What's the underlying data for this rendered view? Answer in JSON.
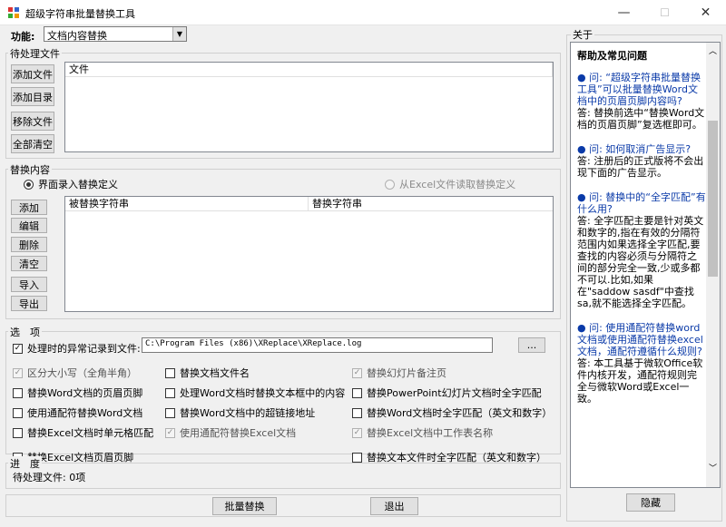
{
  "window": {
    "title": "超级字符串批量替换工具",
    "min": "—",
    "max": "☐",
    "close": "✕"
  },
  "function": {
    "label": "功能:",
    "value": "文档内容替换"
  },
  "pending": {
    "legend": "待处理文件",
    "buttons": [
      "添加文件",
      "添加目录",
      "移除文件",
      "全部清空"
    ],
    "column": "文件"
  },
  "replace": {
    "legend": "替换内容",
    "radio_ui": "界面录入替换定义",
    "radio_excel": "从Excel文件读取替换定义",
    "buttons": [
      "添加",
      "编辑",
      "删除",
      "清空",
      "导入",
      "导出"
    ],
    "columns": [
      "被替换字符串",
      "替换字符串"
    ]
  },
  "options": {
    "legend": "选　项",
    "log_label": "处理时的异常记录到文件:",
    "log_path": "C:\\Program Files (x86)\\XReplace\\XReplace.log",
    "browse": "...",
    "col1": [
      {
        "label": "区分大小写（全角半角）",
        "checked": true,
        "disabled": true
      },
      {
        "label": "替换Word文档的页眉页脚",
        "checked": false,
        "disabled": false
      },
      {
        "label": "使用通配符替换Word文档",
        "checked": false,
        "disabled": false
      },
      {
        "label": "替换Excel文档时单元格匹配",
        "checked": false,
        "disabled": false
      },
      {
        "label": "替换Excel文档页眉页脚",
        "checked": false,
        "disabled": false
      }
    ],
    "col2": [
      {
        "label": "替换文档文件名",
        "checked": false,
        "disabled": false
      },
      {
        "label": "处理Word文档时替换文本框中的内容",
        "checked": false,
        "disabled": false
      },
      {
        "label": "替换Word文档中的超链接地址",
        "checked": false,
        "disabled": false
      },
      {
        "label": "使用通配符替换Excel文档",
        "checked": true,
        "disabled": true
      }
    ],
    "col3": [
      {
        "label": "替换幻灯片备注页",
        "checked": true,
        "disabled": true
      },
      {
        "label": "替换PowerPoint幻灯片文档时全字匹配",
        "checked": false,
        "disabled": false
      },
      {
        "label": "替换Word文档时全字匹配（英文和数字）",
        "checked": false,
        "disabled": false
      },
      {
        "label": "替换Excel文档中工作表名称",
        "checked": true,
        "disabled": true
      },
      {
        "label": "替换文本文件时全字匹配（英文和数字）",
        "checked": false,
        "disabled": false
      }
    ]
  },
  "progress": {
    "legend": "进　度",
    "status": "待处理文件: 0项"
  },
  "bottom": {
    "batch": "批量替换",
    "exit": "退出"
  },
  "about": {
    "legend": "关于",
    "title": "帮助及常见问题",
    "items": [
      {
        "q": "● 问: “超级字符串批量替换工具”可以批量替换Word文档中的页眉页脚内容吗?",
        "a": "答: 替换前选中“替换Word文档的页眉页脚”复选框即可。"
      },
      {
        "q": "● 问: 如何取消广告显示?",
        "a": "答: 注册后的正式版将不会出现下面的广告显示。"
      },
      {
        "q": "● 问: 替换中的“全字匹配”有什么用?",
        "a": "答: 全字匹配主要是针对英文和数字的,指在有效的分隔符范围内如果选择全字匹配,要查找的内容必须与分隔符之间的部分完全一致,少或多都不可以.比如,如果在\"saddow sasdf\"中查找sa,就不能选择全字匹配。"
      },
      {
        "q": "● 问: 使用通配符替换word文档或使用通配符替换excel文档，通配符遵循什么规则?",
        "a": "答: 本工具基于微软Office软件内核开发，通配符规则完全与微软Word或Excel一致。"
      }
    ],
    "hide": "隐藏"
  }
}
